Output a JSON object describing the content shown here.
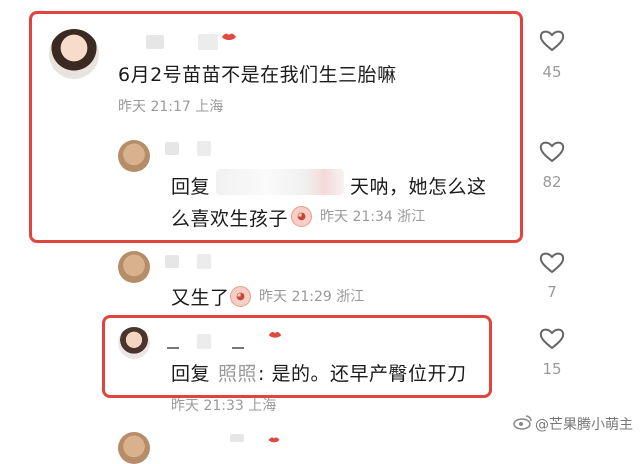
{
  "comments": [
    {
      "text": "6月2号苗苗不是在我们生三胎嘛",
      "time": "昨天 21:17 上海",
      "likes": "45"
    },
    {
      "reply_prefix": "回复",
      "text_line1": "天呐，她怎么这",
      "text_line2": "么喜欢生孩子",
      "time": "昨天 21:34 浙江",
      "likes": "82"
    },
    {
      "text": "又生了",
      "time": "昨天 21:29 浙江",
      "likes": "7"
    },
    {
      "reply_prefix": "回复",
      "reply_name": "照照",
      "text": ": 是的。还早产臀位开刀",
      "time": "昨天 21:33 上海",
      "likes": "15"
    }
  ],
  "watermark": "@芒果腾小萌主",
  "icons": [
    "heart-icon",
    "weibo-icon"
  ],
  "colors": {
    "highlight": "#e0453d",
    "meta": "#9a9a9a"
  }
}
